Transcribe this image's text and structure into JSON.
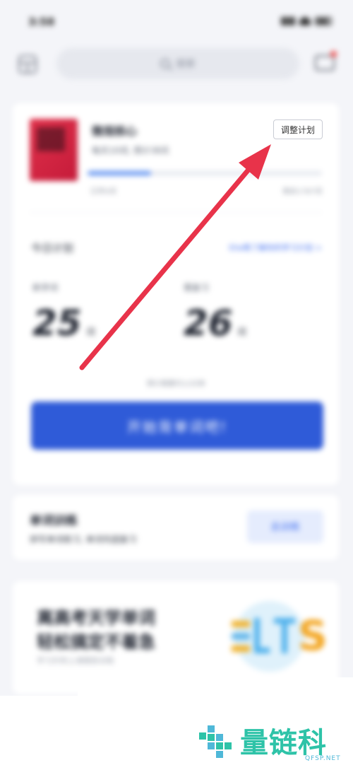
{
  "status_bar": {
    "time": "3:58"
  },
  "top_bar": {
    "search_placeholder": "搜索"
  },
  "book": {
    "title": "微观核心",
    "subtitle": "每天10词, 预计38天",
    "progress_fraction": 0.27,
    "progress_left": "已学0词",
    "progress_right": "剩余1787词"
  },
  "adjust_plan_label": "调整计划",
  "today": {
    "label": "今日计划",
    "link": "Ella等了解你的学习计划 >"
  },
  "stats": {
    "new_label": "新学词",
    "new_value": "25",
    "review_label": "需复习",
    "review_value": "26",
    "unit": "词"
  },
  "note": "预计需要约12分钟",
  "start_button": "开始背单词吧!",
  "training": {
    "title": "单词训练",
    "subtitle": "拼写单词练习, 单词巩固复习",
    "button": "去训练"
  },
  "promo": {
    "line1": "离高考天学单词",
    "line2": "轻松搞定不着急",
    "small": "学习外附上课跟踪训练",
    "art_letters": "IELTS"
  },
  "watermark": {
    "text": "量链科技",
    "sub": "QFSP.NET"
  },
  "colors": {
    "accent": "#2f5bd8",
    "arrow": "#e8334a",
    "book_cover": "#d72340",
    "watermark": "#2ec3a8"
  }
}
